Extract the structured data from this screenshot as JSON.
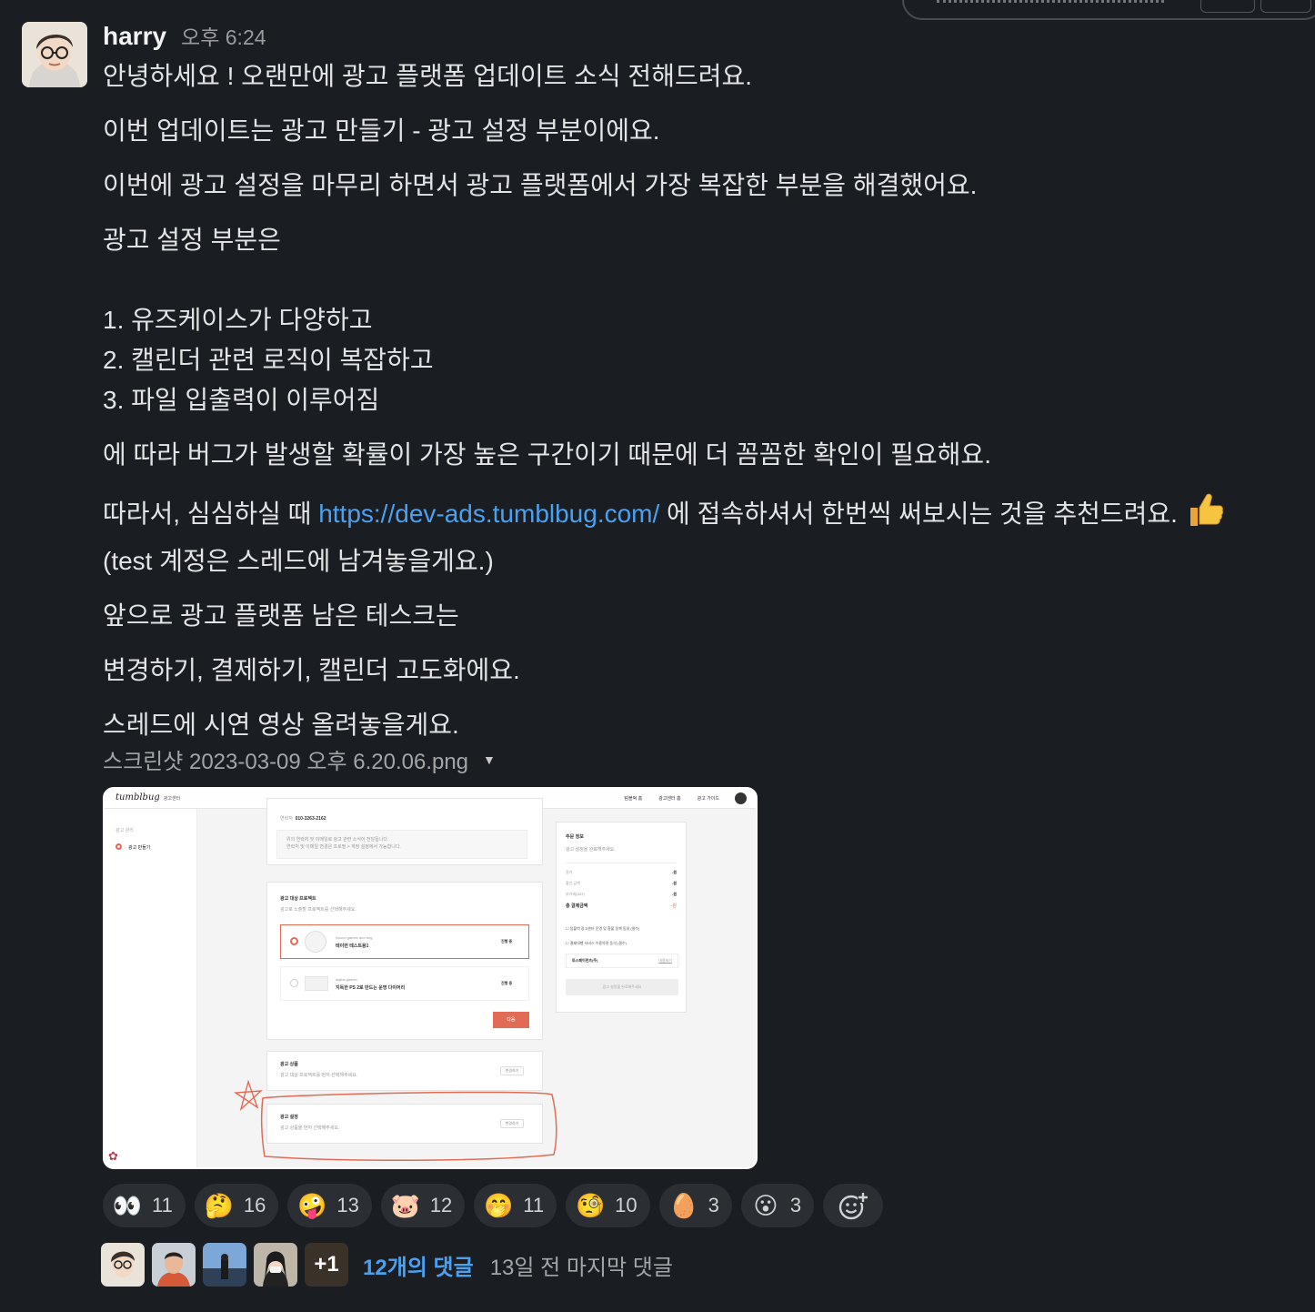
{
  "message": {
    "author": "harry",
    "time": "오후 6:24",
    "lines": {
      "l1": "안녕하세요 ! 오랜만에 광고 플랫폼 업데이트 소식 전해드려요.",
      "l2": "이번 업데이트는 광고 만들기 - 광고 설정 부분이에요.",
      "l3": "이번에 광고 설정을 마무리 하면서 광고 플랫폼에서 가장 복잡한 부분을 해결했어요.",
      "l4": "광고 설정 부분은",
      "li1": "1. 유즈케이스가 다양하고",
      "li2": "2. 캘린더 관련 로직이 복잡하고",
      "li3": "3. 파일 입출력이 이루어짐",
      "l5": "에 따라 버그가 발생할 확률이 가장 높은 구간이기 때문에 더 꼼꼼한 확인이 필요해요.",
      "l6_pre": "따라서, 심심하실 때 ",
      "l6_link": "https://dev-ads.tumblbug.com/",
      "l6_post": " 에 접속하셔서 한번씩 써보시는 것을 추천드려요.",
      "l7": "(test 계정은 스레드에 남겨놓을게요.)",
      "l8": "앞으로 광고 플랫폼 남은 테스크는",
      "l9": "변경하기, 결제하기, 캘린더 고도화에요.",
      "l10": "스레드에 시연 영상 올려놓을게요."
    },
    "link_color": "#4aa1f0",
    "emoji_inline": "thumbs-up"
  },
  "attachment": {
    "filename": "스크린샷 2023-03-09 오후 6.20.06.png"
  },
  "screenshot_ui": {
    "logo": "tumblbug",
    "logo_sub": "광고센터",
    "nav": [
      "텀블벅 홈",
      "광고센터 홈",
      "광고 가이드"
    ],
    "side_items": [
      "광고 관리",
      "광고 만들기"
    ],
    "contact_label": "연락처",
    "contact_value": "010-3263-2162",
    "notes": [
      "위의 연락처 및 이메일로 광고 관련 소식이 전달됩니다.",
      "연락처 및 이메일 변경은 프로필 > 계정 설정에서 가능합니다."
    ],
    "target_title": "광고 대상 프로젝트",
    "target_desc": "광고로 노출할 프로젝트를 선택해주세요.",
    "proj1_maker": "Sound games and frog",
    "proj1_name": "테이번 테스트용1",
    "proj2_maker": "digital games",
    "proj2_name": "지독한 PS 2로 만드는 운명 다이어리",
    "status": "진행 중",
    "next_btn": "다음",
    "product_title": "광고 상품",
    "product_desc": "광고 대상 프로젝트를 먼저 선택해주세요.",
    "setting_title": "광고 설정",
    "setting_desc": "광고 상품을 먼저 선택해주세요.",
    "change_btn": "변경하기",
    "order_title": "주문 정보",
    "order_desc": "광고 설정을 완료해주세요.",
    "order_rows": [
      "정가",
      "할인 금액",
      "부가세(VAT)"
    ],
    "order_val": "-원",
    "total_label": "총 결제금액",
    "agree1": "텀블벅 광고센터 운영 및 환불 정책 동의 (필수)",
    "agree2": "결제대행 서비스 이용약관 동의 (필수)",
    "pay_label": "토스페이먼츠(주)",
    "pay_link": "내용보기",
    "complete_btn": "광고 설정을 완료해주세요"
  },
  "reactions": [
    {
      "emoji": "👀",
      "name": "eyes",
      "count": "11"
    },
    {
      "emoji": "🤔",
      "name": "thinking",
      "count": "16"
    },
    {
      "emoji": "🤪",
      "name": "crazy-face",
      "count": "13"
    },
    {
      "emoji": "🐷",
      "name": "kirby",
      "count": "12"
    },
    {
      "emoji": "🤭",
      "name": "hand-over-mouth",
      "count": "11"
    },
    {
      "emoji": "🧐",
      "name": "monocle",
      "count": "10"
    },
    {
      "emoji": "🥚",
      "name": "egg-face",
      "count": "3"
    },
    {
      "emoji": "😮",
      "name": "open-mouth",
      "count": "3"
    }
  ],
  "thread": {
    "more": "+1",
    "replies": "12개의 댓글",
    "last_reply": "13일 전 마지막 댓글"
  }
}
